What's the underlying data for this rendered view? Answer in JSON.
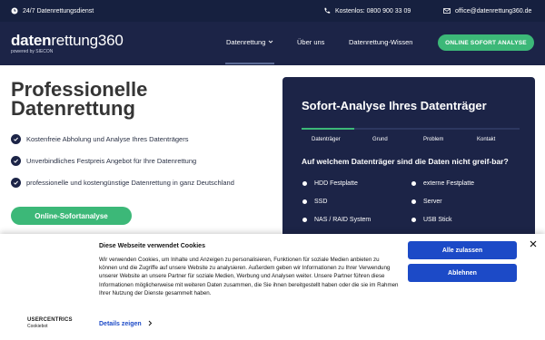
{
  "topbar": {
    "service": "24/7 Datenrettungsdienst",
    "phone": "Kostenlos: 0800 900 33 09",
    "email": "office@datenrettung360.de"
  },
  "brand": {
    "logo_part1": "daten",
    "logo_part2": "rettung360",
    "tagline": "powered by SIECON"
  },
  "nav": {
    "items": [
      "Datenrettung",
      "Über uns",
      "Datenrettung-Wissen"
    ],
    "cta": "ONLINE SOFORT ANALYSE"
  },
  "hero": {
    "title_line1": "Professionelle",
    "title_line2": "Datenrettung",
    "checks": [
      "Kostenfreie Abholung und Analyse Ihres Datenträgers",
      "Unverbindliches Festpreis Angebot für Ihre Datenrettung",
      "professionelle und kostengünstige Datenrettung in ganz Deutschland"
    ],
    "button": "Online-Sofortanalyse"
  },
  "panel": {
    "title": "Sofort-Analyse Ihres Datenträger",
    "steps": [
      "Datenträger",
      "Grund",
      "Problem",
      "Kontakt"
    ],
    "active_step": 1,
    "question": "Auf welchem Datenträger sind die Daten nicht greif-bar?",
    "options": [
      "HDD Festplatte",
      "externe Festplatte",
      "SSD",
      "Server",
      "NAS / RAID System",
      "USB Stick"
    ]
  },
  "cookie": {
    "title": "Diese Webseite verwendet Cookies",
    "text": "Wir verwenden Cookies, um Inhalte und Anzeigen zu personalisieren, Funktionen für soziale Medien anbieten zu können und die Zugriffe auf unsere Website zu analysieren. Außerdem geben wir Informationen zu Ihrer Verwendung unserer Website an unsere Partner für soziale Medien, Werbung und Analysen weiter. Unsere Partner führen diese Informationen möglicherweise mit weiteren Daten zusammen, die Sie ihnen bereitgestellt haben oder die sie im Rahmen Ihrer Nutzung der Dienste gesammelt haben.",
    "details": "Details zeigen",
    "accept": "Alle zulassen",
    "reject": "Ablehnen",
    "logo_line1": "USERCENTRICS",
    "logo_line2": "Cookiebot"
  },
  "colors": {
    "navy": "#1c2447",
    "green": "#3cb878",
    "blue": "#1c4ac7"
  }
}
